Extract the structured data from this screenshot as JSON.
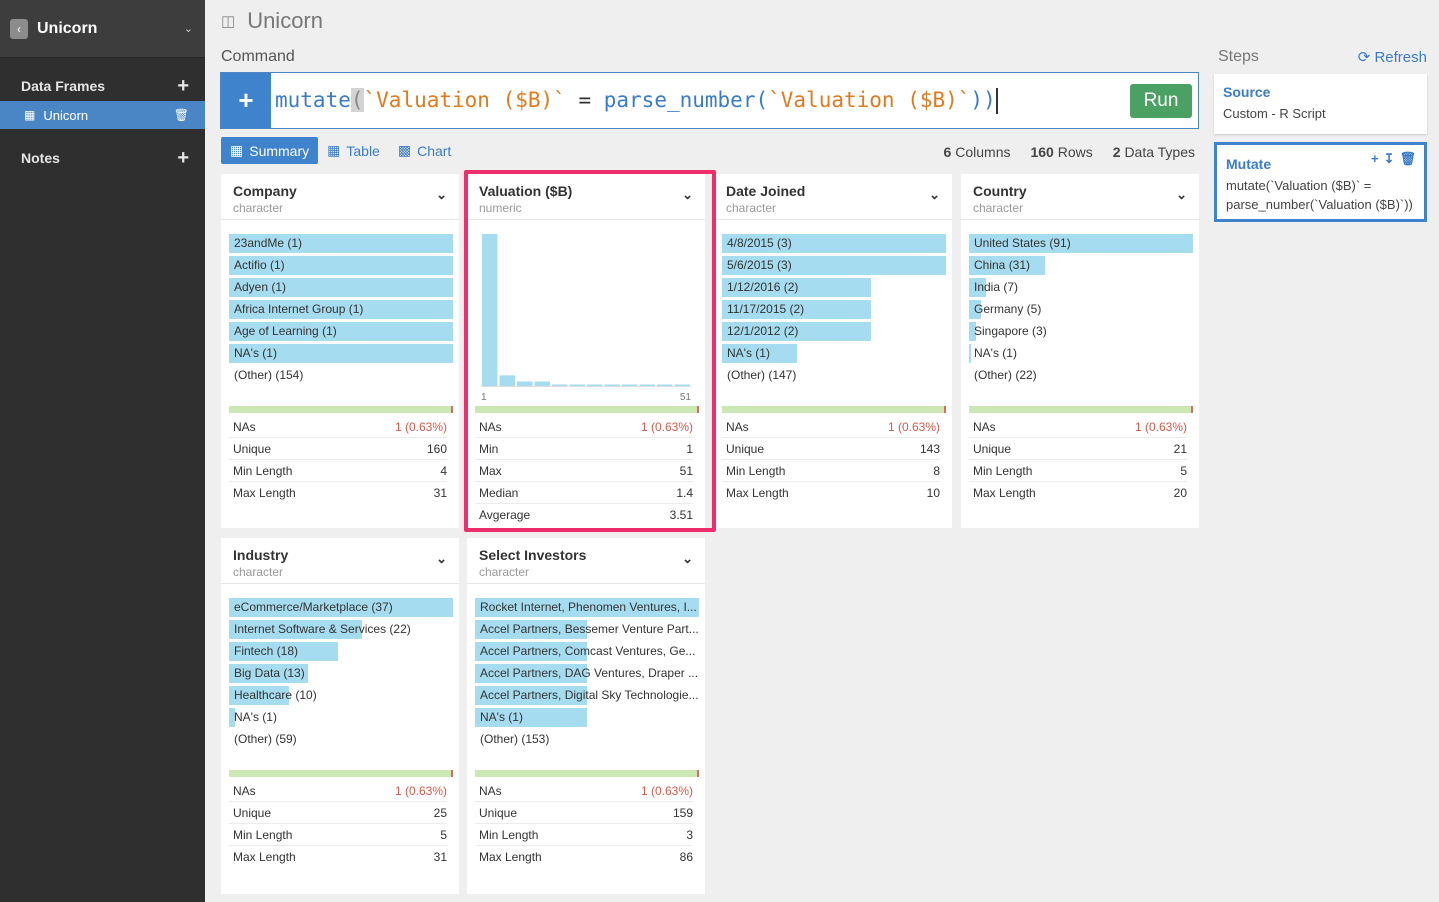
{
  "sidebar": {
    "project": "Unicorn",
    "data_frames_label": "Data Frames",
    "notes_label": "Notes",
    "frames": [
      {
        "label": "Unicorn"
      }
    ]
  },
  "header": {
    "title": "Unicorn"
  },
  "command": {
    "label": "Command",
    "fn1": "mutate",
    "open": "(",
    "str1": "`Valuation ($B)`",
    "eq": " = ",
    "fn2": "parse_number",
    "open2": "(",
    "str2": "`Valuation ($B)`",
    "close": "))",
    "run_label": "Run"
  },
  "tabs": [
    {
      "label": "Summary"
    },
    {
      "label": "Table"
    },
    {
      "label": "Chart"
    }
  ],
  "stats": {
    "columns": "6",
    "columns_label": "Columns",
    "rows": "160",
    "rows_label": "Rows",
    "types": "2",
    "types_label": "Data Types"
  },
  "cards": [
    {
      "name": "Company",
      "type": "character",
      "values": [
        {
          "label": "23andMe (1)",
          "pct": 1
        },
        {
          "label": "Actifio (1)",
          "pct": 1
        },
        {
          "label": "Adyen (1)",
          "pct": 1
        },
        {
          "label": "Africa Internet Group (1)",
          "pct": 1
        },
        {
          "label": "Age of Learning (1)",
          "pct": 1
        },
        {
          "label": "NA's (1)",
          "pct": 1
        },
        {
          "label": "(Other) (154)",
          "pct": 0
        }
      ],
      "stats": [
        {
          "k": "NAs",
          "v": "1 (0.63%)",
          "red": true
        },
        {
          "k": "Unique",
          "v": "160"
        },
        {
          "k": "Min Length",
          "v": "4"
        },
        {
          "k": "Max Length",
          "v": "31"
        }
      ]
    },
    {
      "name": "Valuation ($B)",
      "type": "numeric",
      "hist": {
        "values": [
          100,
          7,
          3,
          3,
          1,
          1,
          1,
          1,
          1,
          1,
          1,
          1
        ],
        "xmin": "1",
        "xmax": "51"
      },
      "stats": [
        {
          "k": "NAs",
          "v": "1 (0.63%)",
          "red": true
        },
        {
          "k": "Min",
          "v": "1"
        },
        {
          "k": "Max",
          "v": "51"
        },
        {
          "k": "Median",
          "v": "1.4"
        },
        {
          "k": "Avgerage",
          "v": "3.51"
        }
      ]
    },
    {
      "name": "Date Joined",
      "type": "character",
      "values": [
        {
          "label": "4/8/2015 (3)",
          "pct": 1
        },
        {
          "label": "5/6/2015 (3)",
          "pct": 1
        },
        {
          "label": "1/12/2016 (2)",
          "pct": 0.667
        },
        {
          "label": "11/17/2015 (2)",
          "pct": 0.667
        },
        {
          "label": "12/1/2012 (2)",
          "pct": 0.667
        },
        {
          "label": "NA's (1)",
          "pct": 0.333
        },
        {
          "label": "(Other) (147)",
          "pct": 0
        }
      ],
      "stats": [
        {
          "k": "NAs",
          "v": "1 (0.63%)",
          "red": true
        },
        {
          "k": "Unique",
          "v": "143"
        },
        {
          "k": "Min Length",
          "v": "8"
        },
        {
          "k": "Max Length",
          "v": "10"
        }
      ]
    },
    {
      "name": "Country",
      "type": "character",
      "values": [
        {
          "label": "United States (91)",
          "pct": 1
        },
        {
          "label": "China (31)",
          "pct": 0.341
        },
        {
          "label": "India (7)",
          "pct": 0.077
        },
        {
          "label": "Germany (5)",
          "pct": 0.055
        },
        {
          "label": "Singapore (3)",
          "pct": 0.033
        },
        {
          "label": "NA's (1)",
          "pct": 0.011
        },
        {
          "label": "(Other) (22)",
          "pct": 0
        }
      ],
      "stats": [
        {
          "k": "NAs",
          "v": "1 (0.63%)",
          "red": true
        },
        {
          "k": "Unique",
          "v": "21"
        },
        {
          "k": "Min Length",
          "v": "5"
        },
        {
          "k": "Max Length",
          "v": "20"
        }
      ]
    },
    {
      "name": "Industry",
      "type": "character",
      "values": [
        {
          "label": "eCommerce/Marketplace (37)",
          "pct": 1
        },
        {
          "label": "Internet Software & Services (22)",
          "pct": 0.595
        },
        {
          "label": "Fintech (18)",
          "pct": 0.486
        },
        {
          "label": "Big Data (13)",
          "pct": 0.351
        },
        {
          "label": "Healthcare (10)",
          "pct": 0.27
        },
        {
          "label": "NA's (1)",
          "pct": 0.027
        },
        {
          "label": "(Other) (59)",
          "pct": 0
        }
      ],
      "stats": [
        {
          "k": "NAs",
          "v": "1 (0.63%)",
          "red": true
        },
        {
          "k": "Unique",
          "v": "25"
        },
        {
          "k": "Min Length",
          "v": "5"
        },
        {
          "k": "Max Length",
          "v": "31"
        }
      ]
    },
    {
      "name": "Select Investors",
      "type": "character",
      "values": [
        {
          "label": "Rocket Internet, Phenomen Ventures, I...",
          "pct": 1
        },
        {
          "label": "Accel Partners, Bessemer Venture Part...",
          "pct": 0.5
        },
        {
          "label": "Accel Partners, Comcast Ventures, Ge...",
          "pct": 0.5
        },
        {
          "label": "Accel Partners, DAG Ventures, Draper ...",
          "pct": 0.5
        },
        {
          "label": "Accel Partners, Digital Sky Technologie...",
          "pct": 0.5
        },
        {
          "label": "NA's (1)",
          "pct": 0.5
        },
        {
          "label": "(Other) (153)",
          "pct": 0
        }
      ],
      "stats": [
        {
          "k": "NAs",
          "v": "1 (0.63%)",
          "red": true
        },
        {
          "k": "Unique",
          "v": "159"
        },
        {
          "k": "Min Length",
          "v": "3"
        },
        {
          "k": "Max Length",
          "v": "86"
        }
      ]
    }
  ],
  "steps": {
    "label": "Steps",
    "refresh_label": "Refresh",
    "items": [
      {
        "name": "Source",
        "desc": "Custom - R Script"
      },
      {
        "name": "Mutate",
        "desc": "mutate(`Valuation ($B)` = parse_number(`Valuation ($B)`))"
      }
    ]
  }
}
